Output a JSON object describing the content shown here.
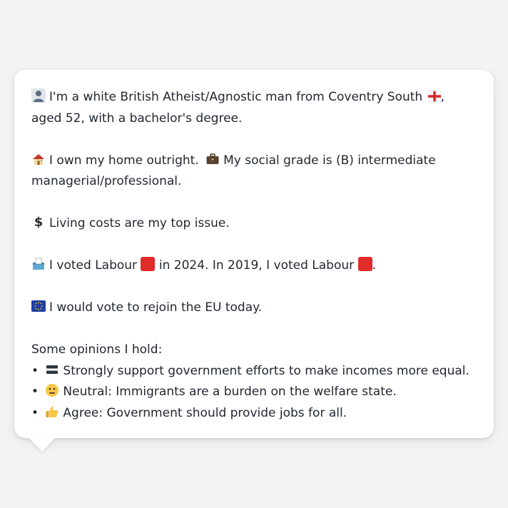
{
  "colors": {
    "page_background": "#f1f3f5",
    "card_background": "#ffffff",
    "text": "#222831",
    "labour_red": "#e02b2b"
  },
  "profile": {
    "intro_text": "I'm a white British Atheist/Agnostic man from Coventry South",
    "intro_icon": "person-silhouette-icon",
    "england_flag_icon": "england-flag-icon",
    "intro_suffix": ", aged 52, with a bachelor's degree.",
    "home_icon": "house-icon",
    "home_text": "I own my home outright.",
    "briefcase_icon": "briefcase-icon",
    "grade_text": "My social grade is (B) intermediate managerial/professional.",
    "dollar_icon": "dollar-sign-icon",
    "issue_text": "Living costs are my top issue.",
    "ballot_icon": "ballot-box-icon",
    "vote_prefix": "I voted Labour",
    "vote_mid": "in 2024. In 2019, I voted Labour",
    "vote_end": ".",
    "eu_flag_icon": "eu-flag-icon",
    "eu_text": "I would vote to rejoin the EU today.",
    "opinions_heading": "Some opinions I hold:",
    "opinions": [
      {
        "bullet": "•",
        "icon": "equals-icon",
        "text": "Strongly support government efforts to make incomes more equal."
      },
      {
        "bullet": "•",
        "icon": "neutral-face-icon",
        "text": "Neutral: Immigrants are a burden on the welfare state."
      },
      {
        "bullet": "•",
        "icon": "thumbs-up-icon",
        "text": "Agree: Government should provide jobs for all."
      }
    ]
  }
}
